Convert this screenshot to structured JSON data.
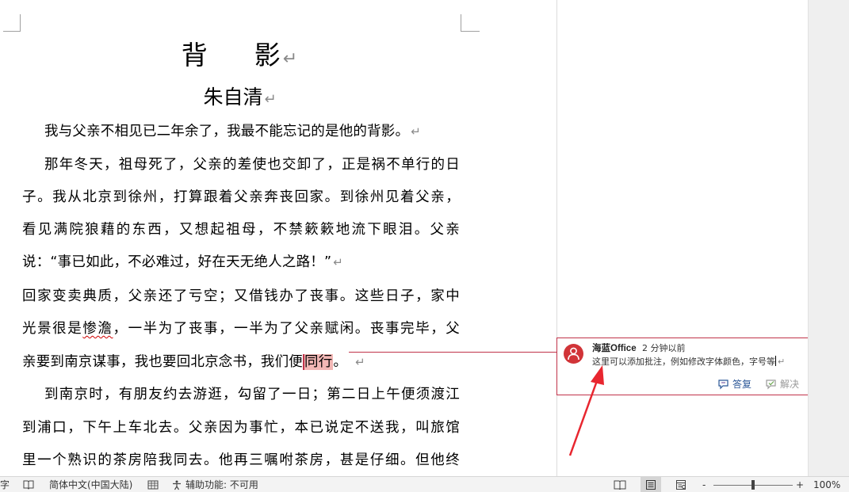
{
  "document": {
    "title_left": "背",
    "title_right": "影",
    "author": "朱自清",
    "para_mark": "↵",
    "lines": [
      "我与父亲不相见已二年余了，我最不能忘记的是他的背影。",
      "那年冬天，祖母死了，父亲的差使也交卸了，正是祸不单行的日",
      "子。我从北京到徐州，打算跟着父亲奔丧回家。到徐州见着父亲，",
      "看见满院狼藉的东西，又想起祖母，不禁簌簌地流下眼泪。父亲",
      "说：“事已如此，不必难过，好在天无绝人之路！”",
      "回家变卖典质，父亲还了亏空；又借钱办了丧事。这些日子，家中",
      "光景很是",
      "惨澹",
      "，一半为了丧事，一半为了父亲赋闲。丧事完毕，父",
      "亲要到南京谋事，我也要回北京念书，我们便",
      "同行",
      "。",
      "到南京时，有朋友约去游逛，勾留了一日；第二日上午便须渡江",
      "到浦口，下午上车北去。父亲因为事忙，本已说定不送我，叫旅馆",
      "里一个熟识的茶房陪我同去。他再三嘱咐茶房，甚是仔细。但他终"
    ]
  },
  "comment": {
    "author": "海蓝Office",
    "time": "2 分钟以前",
    "text": "这里可以添加批注，例如修改字体颜色，字号等",
    "reply_label": "答复",
    "resolve_label": "解决"
  },
  "statusbar": {
    "word_fragment": "字",
    "language": "简体中文(中国大陆)",
    "accessibility": "辅助功能: 不可用",
    "zoom": "100%",
    "zoom_minus": "-",
    "zoom_plus": "+"
  },
  "colors": {
    "comment_accent": "#c0334a",
    "anchor_highlight": "#f2b7b5",
    "avatar": "#d13438",
    "arrow": "#e8262f"
  }
}
